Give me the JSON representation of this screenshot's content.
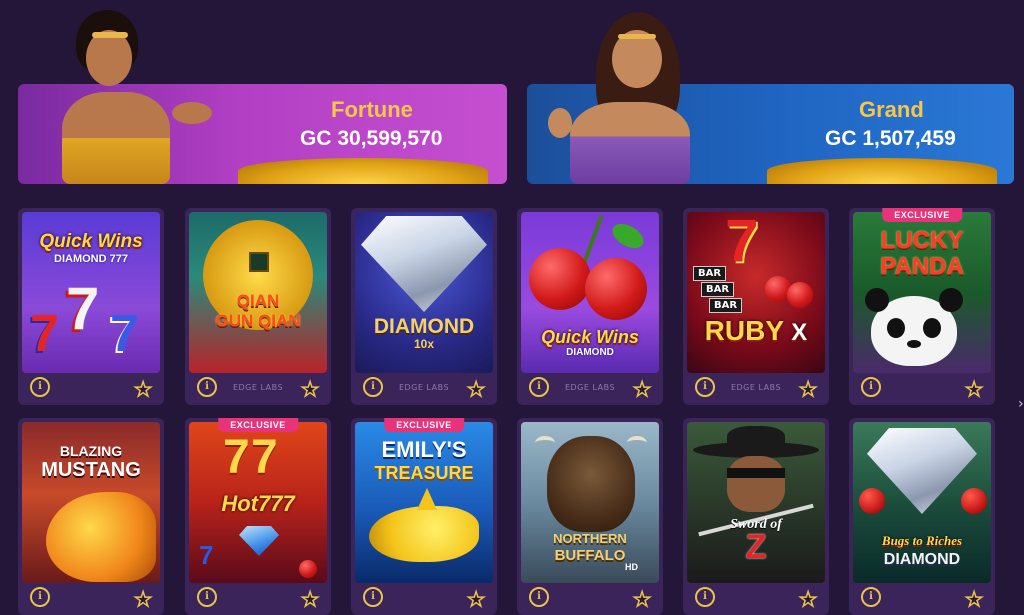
{
  "jackpots": [
    {
      "title": "Fortune",
      "amount": "GC 30,599,570"
    },
    {
      "title": "Grand",
      "amount": "GC 1,507,459"
    }
  ],
  "games": [
    {
      "name_line1": "Quick Wins",
      "name_line2": "DIAMOND 777",
      "provider": "",
      "exclusive": false
    },
    {
      "name_line1": "QIAN",
      "name_line2": "GUN QIAN",
      "provider": "EDGE LABS",
      "exclusive": false
    },
    {
      "name_line1": "DIAMOND",
      "name_line2": "10x",
      "provider": "EDGE LABS",
      "exclusive": false
    },
    {
      "name_line1": "Quick Wins",
      "name_line2": "DIAMOND",
      "provider": "EDGE LABS",
      "exclusive": false
    },
    {
      "name_line1": "RUBY",
      "name_line2": "X",
      "provider": "EDGE LABS",
      "exclusive": false
    },
    {
      "name_line1": "LUCKY",
      "name_line2": "PANDA",
      "provider": "",
      "exclusive": true
    },
    {
      "name_line1": "BLAZING",
      "name_line2": "MUSTANG",
      "provider": "",
      "exclusive": false
    },
    {
      "name_line1": "Hot",
      "name_line2": "777",
      "provider": "",
      "exclusive": true
    },
    {
      "name_line1": "EMILY'S",
      "name_line2": "TREASURE",
      "provider": "",
      "exclusive": true
    },
    {
      "name_line1": "NORTHERN",
      "name_line2": "BUFFALO",
      "provider": "",
      "exclusive": false
    },
    {
      "name_line1": "Sword of",
      "name_line2": "Z",
      "provider": "",
      "exclusive": false
    },
    {
      "name_line1": "Bugs to Riches",
      "name_line2": "DIAMOND",
      "provider": "",
      "exclusive": false
    }
  ],
  "labels": {
    "exclusive": "EXCLUSIVE",
    "info": "i",
    "star": "★",
    "bar": "BAR",
    "seven": "7",
    "hd": "HD"
  },
  "icons": {
    "info": "info-icon",
    "favorite": "star-icon",
    "scroll": "chevron-right-icon"
  },
  "colors": {
    "background": "#241638",
    "tile": "#3a245a",
    "gold": "#f7c74a",
    "badge": "#e8327a"
  }
}
